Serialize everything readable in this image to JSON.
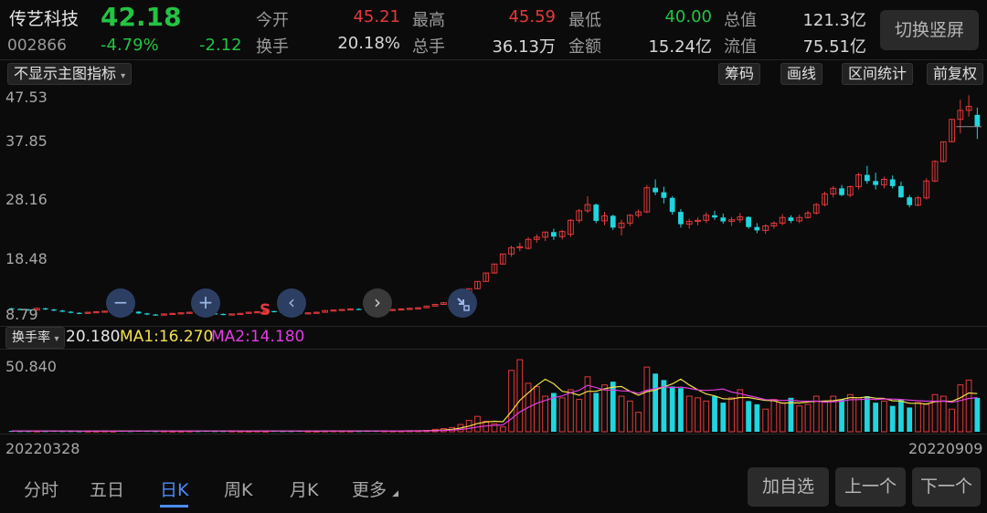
{
  "header": {
    "stock_name": "传艺科技",
    "stock_code": "002866",
    "price": "42.18",
    "change_pct": "-4.79%",
    "change_amt": "-2.12",
    "quotes": [
      {
        "label": "今开",
        "value": "45.21",
        "color": "red"
      },
      {
        "label": "最高",
        "value": "45.59",
        "color": "red"
      },
      {
        "label": "最低",
        "value": "40.00",
        "color": "green"
      },
      {
        "label": "总值",
        "value": "121.3亿",
        "color": "white"
      },
      {
        "label": "换手",
        "value": "20.18%",
        "color": "white"
      },
      {
        "label": "总手",
        "value": "36.13万",
        "color": "white"
      },
      {
        "label": "金额",
        "value": "15.24亿",
        "color": "white"
      },
      {
        "label": "流值",
        "value": "75.51亿",
        "color": "white"
      }
    ],
    "switch_label": "切换竖屏"
  },
  "toolbar": {
    "indicator_select": "不显示主图指标",
    "buttons": [
      "筹码",
      "画线",
      "区间统计",
      "前复权"
    ]
  },
  "main_chart": {
    "y_labels": [
      "47.53",
      "37.85",
      "28.16",
      "18.48",
      "8.79"
    ],
    "marker": "S",
    "zoom_out": "−",
    "zoom_in": "+",
    "prev": "‹",
    "next": "›",
    "colors": {
      "up": "#e4393c",
      "down": "#1fd6df",
      "bg": "#0b0b0b"
    }
  },
  "volume_panel": {
    "selector": "换手率",
    "value": "20.180",
    "ma1_label": "MA1:16.270",
    "ma2_label": "MA2:14.180",
    "y_label": "50.840",
    "date_start": "20220328",
    "date_end": "20220909",
    "colors": {
      "ma1": "#f2e04b",
      "ma2": "#e03ce0"
    }
  },
  "bottom_nav": {
    "tabs": [
      "分时",
      "五日",
      "日K",
      "周K",
      "月K",
      "更多"
    ],
    "active_tab": "日K",
    "actions": [
      "加自选",
      "上一个",
      "下一个"
    ]
  },
  "chart_data": {
    "type": "candlestick",
    "y_range": [
      8.79,
      47.53
    ],
    "period": [
      "20220328",
      "20220909"
    ],
    "candles_ohlc": [
      [
        9.8,
        9.9,
        9.6,
        9.7
      ],
      [
        9.7,
        9.8,
        9.5,
        9.6
      ],
      [
        9.6,
        9.7,
        9.4,
        9.5
      ],
      [
        9.5,
        9.9,
        9.4,
        9.8
      ],
      [
        9.8,
        9.9,
        9.5,
        9.6
      ],
      [
        9.6,
        9.7,
        9.3,
        9.4
      ],
      [
        9.4,
        9.5,
        9.1,
        9.2
      ],
      [
        9.2,
        9.3,
        8.9,
        9.0
      ],
      [
        9.0,
        9.1,
        8.8,
        8.9
      ],
      [
        8.9,
        9.2,
        8.8,
        9.1
      ],
      [
        9.1,
        9.3,
        9.0,
        9.2
      ],
      [
        9.2,
        9.4,
        9.1,
        9.3
      ],
      [
        9.3,
        9.5,
        9.2,
        9.4
      ],
      [
        9.4,
        9.5,
        9.2,
        9.3
      ],
      [
        9.3,
        9.4,
        9.1,
        9.2
      ],
      [
        9.2,
        9.3,
        8.8,
        8.9
      ],
      [
        8.9,
        9.0,
        8.6,
        8.7
      ],
      [
        8.7,
        8.8,
        8.5,
        8.6
      ],
      [
        8.6,
        8.9,
        8.5,
        8.8
      ],
      [
        8.8,
        9.0,
        8.7,
        8.9
      ],
      [
        8.9,
        9.1,
        8.8,
        9.0
      ],
      [
        9.0,
        9.2,
        8.9,
        9.1
      ],
      [
        9.1,
        9.2,
        8.9,
        9.0
      ],
      [
        9.0,
        9.1,
        8.8,
        8.9
      ],
      [
        8.9,
        9.0,
        8.7,
        8.8
      ],
      [
        8.8,
        8.9,
        8.6,
        8.7
      ],
      [
        8.7,
        8.9,
        8.6,
        8.8
      ],
      [
        8.8,
        9.0,
        8.7,
        8.9
      ],
      [
        8.9,
        9.2,
        8.8,
        9.1
      ],
      [
        9.1,
        9.3,
        9.0,
        9.2
      ],
      [
        9.2,
        9.4,
        9.1,
        9.3
      ],
      [
        9.3,
        9.4,
        9.1,
        9.2
      ],
      [
        9.2,
        9.3,
        9.0,
        9.1
      ],
      [
        9.1,
        9.2,
        8.9,
        9.0
      ],
      [
        9.0,
        9.1,
        8.8,
        8.9
      ],
      [
        8.9,
        9.1,
        8.8,
        9.0
      ],
      [
        9.0,
        9.2,
        8.9,
        9.1
      ],
      [
        9.1,
        9.5,
        9.0,
        9.4
      ],
      [
        9.4,
        9.6,
        9.3,
        9.5
      ],
      [
        9.5,
        9.7,
        9.4,
        9.6
      ],
      [
        9.6,
        9.8,
        9.5,
        9.7
      ],
      [
        9.7,
        9.8,
        9.5,
        9.6
      ],
      [
        9.6,
        9.7,
        9.4,
        9.5
      ],
      [
        9.5,
        9.6,
        9.3,
        9.4
      ],
      [
        9.4,
        9.6,
        9.3,
        9.5
      ],
      [
        9.5,
        9.7,
        9.4,
        9.6
      ],
      [
        9.6,
        9.8,
        9.5,
        9.7
      ],
      [
        9.7,
        9.9,
        9.6,
        9.8
      ],
      [
        9.8,
        10.0,
        9.7,
        9.9
      ],
      [
        9.9,
        10.3,
        9.8,
        10.2
      ],
      [
        10.2,
        10.6,
        10.1,
        10.5
      ],
      [
        10.5,
        10.9,
        10.4,
        10.8
      ],
      [
        10.8,
        11.2,
        10.7,
        11.1
      ],
      [
        11.1,
        12.2,
        11.0,
        12.1
      ],
      [
        12.1,
        13.3,
        12.0,
        13.3
      ],
      [
        13.3,
        14.6,
        13.2,
        14.6
      ],
      [
        14.6,
        16.1,
        14.5,
        16.1
      ],
      [
        16.1,
        17.7,
        16.0,
        17.7
      ],
      [
        17.7,
        19.5,
        17.6,
        19.5
      ],
      [
        19.5,
        21.0,
        19.0,
        20.6
      ],
      [
        20.6,
        21.5,
        20.0,
        20.8
      ],
      [
        20.5,
        22.5,
        20.3,
        22.1
      ],
      [
        22.1,
        23.0,
        21.5,
        22.5
      ],
      [
        22.5,
        23.5,
        21.8,
        23.4
      ],
      [
        23.4,
        24.0,
        22.0,
        22.6
      ],
      [
        22.6,
        23.8,
        22.1,
        23.5
      ],
      [
        23.0,
        25.7,
        22.5,
        25.5
      ],
      [
        25.5,
        27.5,
        25.0,
        27.2
      ],
      [
        27.2,
        29.8,
        26.8,
        28.3
      ],
      [
        28.3,
        28.5,
        25.0,
        25.4
      ],
      [
        25.4,
        27.0,
        24.6,
        26.3
      ],
      [
        26.3,
        26.5,
        23.8,
        24.2
      ],
      [
        24.2,
        25.6,
        22.8,
        25.0
      ],
      [
        25.0,
        26.6,
        24.5,
        26.4
      ],
      [
        26.4,
        27.4,
        26.0,
        27.0
      ],
      [
        27.0,
        31.8,
        26.8,
        31.3
      ],
      [
        31.3,
        32.8,
        30.0,
        30.5
      ],
      [
        30.5,
        31.5,
        28.5,
        29.5
      ],
      [
        29.5,
        29.8,
        26.5,
        27.0
      ],
      [
        27.0,
        27.5,
        24.2,
        24.8
      ],
      [
        24.8,
        25.8,
        24.0,
        25.3
      ],
      [
        25.3,
        26.0,
        24.6,
        25.5
      ],
      [
        25.5,
        26.9,
        25.0,
        26.4
      ],
      [
        26.4,
        27.2,
        25.6,
        26.0
      ],
      [
        26.0,
        26.7,
        24.9,
        25.3
      ],
      [
        25.3,
        26.1,
        24.5,
        25.6
      ],
      [
        25.6,
        26.8,
        25.1,
        26.1
      ],
      [
        26.1,
        26.2,
        24.0,
        24.3
      ],
      [
        24.3,
        25.0,
        23.2,
        23.7
      ],
      [
        23.7,
        24.8,
        23.1,
        24.5
      ],
      [
        24.5,
        25.3,
        24.0,
        25.0
      ],
      [
        25.0,
        26.6,
        24.6,
        26.0
      ],
      [
        26.0,
        26.4,
        25.0,
        25.4
      ],
      [
        25.4,
        26.5,
        25.0,
        26.0
      ],
      [
        26.0,
        27.2,
        25.8,
        26.8
      ],
      [
        26.8,
        28.6,
        26.5,
        28.3
      ],
      [
        28.3,
        30.6,
        28.0,
        30.2
      ],
      [
        30.2,
        31.6,
        29.6,
        31.2
      ],
      [
        31.2,
        31.8,
        29.8,
        30.0
      ],
      [
        30.0,
        31.7,
        29.6,
        31.5
      ],
      [
        31.5,
        34.0,
        31.0,
        33.6
      ],
      [
        33.6,
        35.2,
        32.0,
        32.5
      ],
      [
        32.5,
        34.0,
        31.0,
        31.8
      ],
      [
        31.8,
        33.3,
        31.2,
        32.8
      ],
      [
        32.8,
        33.5,
        31.2,
        31.6
      ],
      [
        31.6,
        32.4,
        29.5,
        29.6
      ],
      [
        29.6,
        30.0,
        27.8,
        28.2
      ],
      [
        28.2,
        29.8,
        28.0,
        29.5
      ],
      [
        29.5,
        33.0,
        29.2,
        32.5
      ],
      [
        32.5,
        36.2,
        32.3,
        36.0
      ],
      [
        36.0,
        39.5,
        35.8,
        39.5
      ],
      [
        39.5,
        43.6,
        39.5,
        43.5
      ],
      [
        43.5,
        47.0,
        41.0,
        45.1
      ],
      [
        45.1,
        47.8,
        44.0,
        45.8
      ],
      [
        44.3,
        45.6,
        40.0,
        42.2
      ]
    ],
    "turnover_rate": [
      0.5,
      0.4,
      0.4,
      0.5,
      0.4,
      0.5,
      0.4,
      0.4,
      0.3,
      0.4,
      0.4,
      0.5,
      0.4,
      0.5,
      0.4,
      0.6,
      0.5,
      0.4,
      0.5,
      0.4,
      0.4,
      0.5,
      0.4,
      0.5,
      0.4,
      0.4,
      0.5,
      0.4,
      0.4,
      0.5,
      0.4,
      0.5,
      0.4,
      0.4,
      0.5,
      0.4,
      0.4,
      0.5,
      0.6,
      0.5,
      0.5,
      0.4,
      0.5,
      0.5,
      0.6,
      0.5,
      0.5,
      0.6,
      0.6,
      0.8,
      1.5,
      2.0,
      2.6,
      4.5,
      7.0,
      9.5,
      6.5,
      5.0,
      3.0,
      38.0,
      44.6,
      30.0,
      28.0,
      22.0,
      24.0,
      21.0,
      26.0,
      20.0,
      34.0,
      24.0,
      29.0,
      31.0,
      22.0,
      19.0,
      12.0,
      40.0,
      36.0,
      32.0,
      28.0,
      27.0,
      22.0,
      21.0,
      19.0,
      22.0,
      18.0,
      21.0,
      26.0,
      19.0,
      17.0,
      14.0,
      20.0,
      18.0,
      21.0,
      16.0,
      17.0,
      22.0,
      19.0,
      22.0,
      20.0,
      23.0,
      21.0,
      22.0,
      18.0,
      19.0,
      16.0,
      20.0,
      15.0,
      18.0,
      17.0,
      23.0,
      22.0,
      14.0,
      29.0,
      32.0,
      21.0
    ],
    "ma1": [
      16.27
    ],
    "ma2": [
      14.18
    ]
  }
}
